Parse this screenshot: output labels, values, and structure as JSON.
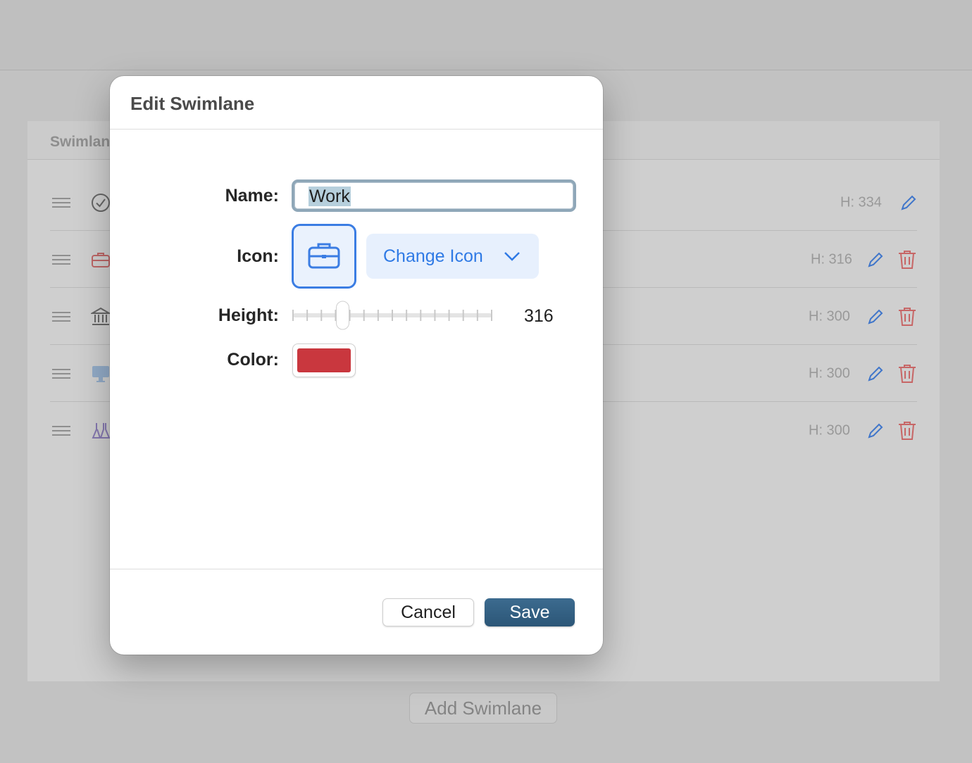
{
  "background": {
    "panel_header_label": "Swimlan",
    "lanes": [
      {
        "height_label": "H: 334",
        "icon": "checkmark-circle-icon",
        "deletable": false
      },
      {
        "height_label": "H: 316",
        "icon": "briefcase-icon",
        "deletable": true
      },
      {
        "height_label": "H: 300",
        "icon": "bank-icon",
        "deletable": true
      },
      {
        "height_label": "H: 300",
        "icon": "desktop-icon",
        "deletable": true
      },
      {
        "height_label": "H: 300",
        "icon": "flask-icon",
        "deletable": true
      }
    ],
    "add_button_label": "Add Swimlane"
  },
  "dialog": {
    "title": "Edit Swimlane",
    "name_label": "Name:",
    "name_value": "Work",
    "icon_label": "Icon:",
    "icon_name": "briefcase-icon",
    "change_icon_label": "Change Icon",
    "height_label": "Height:",
    "height_value": "316",
    "height_slider_fraction": 0.25,
    "color_label": "Color:",
    "color_value": "#c9373e",
    "cancel_label": "Cancel",
    "save_label": "Save"
  },
  "colors": {
    "accent": "#3b7de3",
    "save_button": "#2f5a7c",
    "delete": "#e06a6a",
    "edit": "#3b7de3"
  }
}
